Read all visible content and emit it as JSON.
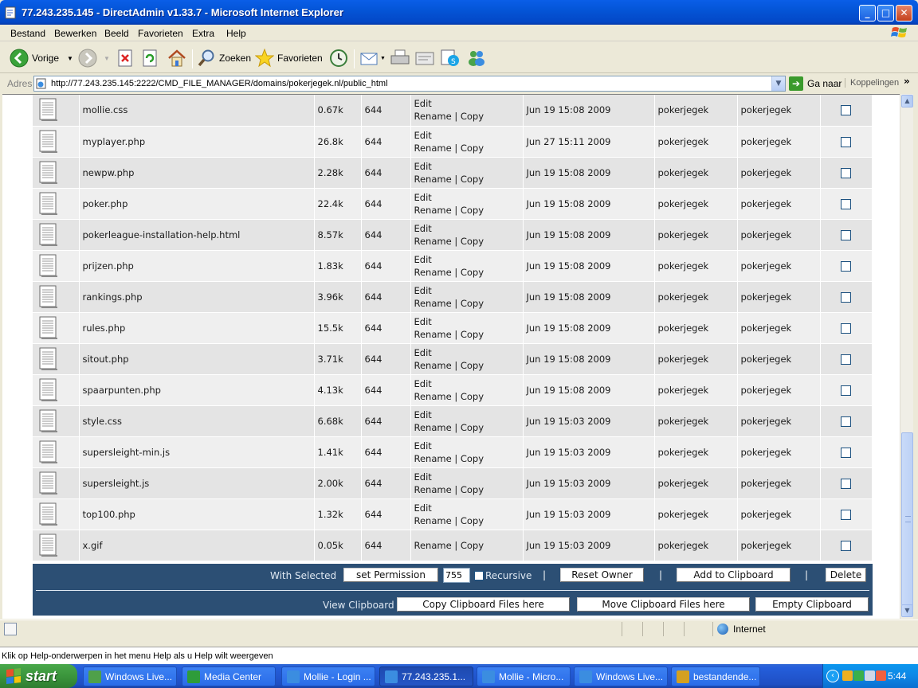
{
  "window": {
    "title": "77.243.235.145 - DirectAdmin v1.33.7 - Microsoft Internet Explorer",
    "min": "_",
    "max": "□",
    "close": "✕"
  },
  "menu": [
    "Bestand",
    "Bewerken",
    "Beeld",
    "Favorieten",
    "Extra",
    "Help"
  ],
  "toolbar": {
    "back": "Vorige",
    "search": "Zoeken",
    "favorites": "Favorieten"
  },
  "address": {
    "label": "Adres",
    "url": "http://77.243.235.145:2222/CMD_FILE_MANAGER/domains/pokerjegek.nl/public_html",
    "go": "Ga naar",
    "links": "Koppelingen",
    "links_chev": "»"
  },
  "files": [
    {
      "name": "mollie.css",
      "size": "0.67k",
      "perm": "644",
      "edit": "Edit",
      "rename": "Rename",
      "copy": "Copy",
      "date": "Jun 19 15:08 2009",
      "owner": "pokerjegek",
      "group": "pokerjegek"
    },
    {
      "name": "myplayer.php",
      "size": "26.8k",
      "perm": "644",
      "edit": "Edit",
      "rename": "Rename",
      "copy": "Copy",
      "date": "Jun 27 15:11 2009",
      "owner": "pokerjegek",
      "group": "pokerjegek"
    },
    {
      "name": "newpw.php",
      "size": "2.28k",
      "perm": "644",
      "edit": "Edit",
      "rename": "Rename",
      "copy": "Copy",
      "date": "Jun 19 15:08 2009",
      "owner": "pokerjegek",
      "group": "pokerjegek"
    },
    {
      "name": "poker.php",
      "size": "22.4k",
      "perm": "644",
      "edit": "Edit",
      "rename": "Rename",
      "copy": "Copy",
      "date": "Jun 19 15:08 2009",
      "owner": "pokerjegek",
      "group": "pokerjegek"
    },
    {
      "name": "pokerleague-installation-help.html",
      "size": "8.57k",
      "perm": "644",
      "edit": "Edit",
      "rename": "Rename",
      "copy": "Copy",
      "date": "Jun 19 15:08 2009",
      "owner": "pokerjegek",
      "group": "pokerjegek"
    },
    {
      "name": "prijzen.php",
      "size": "1.83k",
      "perm": "644",
      "edit": "Edit",
      "rename": "Rename",
      "copy": "Copy",
      "date": "Jun 19 15:08 2009",
      "owner": "pokerjegek",
      "group": "pokerjegek"
    },
    {
      "name": "rankings.php",
      "size": "3.96k",
      "perm": "644",
      "edit": "Edit",
      "rename": "Rename",
      "copy": "Copy",
      "date": "Jun 19 15:08 2009",
      "owner": "pokerjegek",
      "group": "pokerjegek"
    },
    {
      "name": "rules.php",
      "size": "15.5k",
      "perm": "644",
      "edit": "Edit",
      "rename": "Rename",
      "copy": "Copy",
      "date": "Jun 19 15:08 2009",
      "owner": "pokerjegek",
      "group": "pokerjegek"
    },
    {
      "name": "sitout.php",
      "size": "3.71k",
      "perm": "644",
      "edit": "Edit",
      "rename": "Rename",
      "copy": "Copy",
      "date": "Jun 19 15:08 2009",
      "owner": "pokerjegek",
      "group": "pokerjegek"
    },
    {
      "name": "spaarpunten.php",
      "size": "4.13k",
      "perm": "644",
      "edit": "Edit",
      "rename": "Rename",
      "copy": "Copy",
      "date": "Jun 19 15:08 2009",
      "owner": "pokerjegek",
      "group": "pokerjegek"
    },
    {
      "name": "style.css",
      "size": "6.68k",
      "perm": "644",
      "edit": "Edit",
      "rename": "Rename",
      "copy": "Copy",
      "date": "Jun 19 15:03 2009",
      "owner": "pokerjegek",
      "group": "pokerjegek"
    },
    {
      "name": "supersleight-min.js",
      "size": "1.41k",
      "perm": "644",
      "edit": "Edit",
      "rename": "Rename",
      "copy": "Copy",
      "date": "Jun 19 15:03 2009",
      "owner": "pokerjegek",
      "group": "pokerjegek"
    },
    {
      "name": "supersleight.js",
      "size": "2.00k",
      "perm": "644",
      "edit": "Edit",
      "rename": "Rename",
      "copy": "Copy",
      "date": "Jun 19 15:03 2009",
      "owner": "pokerjegek",
      "group": "pokerjegek"
    },
    {
      "name": "top100.php",
      "size": "1.32k",
      "perm": "644",
      "edit": "Edit",
      "rename": "Rename",
      "copy": "Copy",
      "date": "Jun 19 15:03 2009",
      "owner": "pokerjegek",
      "group": "pokerjegek"
    },
    {
      "name": "x.gif",
      "size": "0.05k",
      "perm": "644",
      "edit": "",
      "rename": "Rename",
      "copy": "Copy",
      "date": "Jun 19 15:03 2009",
      "owner": "pokerjegek",
      "group": "pokerjegek"
    }
  ],
  "actions": {
    "with_selected": "With Selected",
    "set_permission": "set Permission",
    "permission_value": "755",
    "recursive": "Recursive",
    "reset_owner": "Reset Owner",
    "add_to_clipboard": "Add to Clipboard",
    "delete": "Delete",
    "view_clipboard": "View Clipboard",
    "copy_clipboard": "Copy Clipboard Files here",
    "move_clipboard": "Move Clipboard Files here",
    "empty_clipboard": "Empty Clipboard",
    "pipe": "|"
  },
  "status": {
    "zone": "Internet"
  },
  "help_message": "Klik op Help-onderwerpen in het menu Help als u Help wilt weergeven",
  "taskbar": {
    "start": "start",
    "tasks": [
      {
        "label": "Windows Live...",
        "icon": "messenger-icon",
        "color": "#4fa04a",
        "active": false
      },
      {
        "label": "Media Center",
        "icon": "media-center-icon",
        "color": "#2e9c3a",
        "active": false
      },
      {
        "label": "Mollie - Login ...",
        "icon": "ie-icon",
        "color": "#3b8de0",
        "active": false
      },
      {
        "label": "77.243.235.1...",
        "icon": "ie-icon",
        "color": "#3b8de0",
        "active": true
      },
      {
        "label": "Mollie - Micro...",
        "icon": "ie-icon",
        "color": "#3b8de0",
        "active": false
      },
      {
        "label": "Windows Live...",
        "icon": "ie-icon",
        "color": "#3b8de0",
        "active": false
      },
      {
        "label": "bestandende...",
        "icon": "file-icon",
        "color": "#d4a020",
        "active": false
      }
    ],
    "clock": "5:44",
    "tray_chev": "‹"
  },
  "colors": {
    "action_bar": "#2c4f74",
    "row_odd": "#e4e4e4",
    "row_even": "#efefef",
    "titlebar": "#0455d7"
  }
}
